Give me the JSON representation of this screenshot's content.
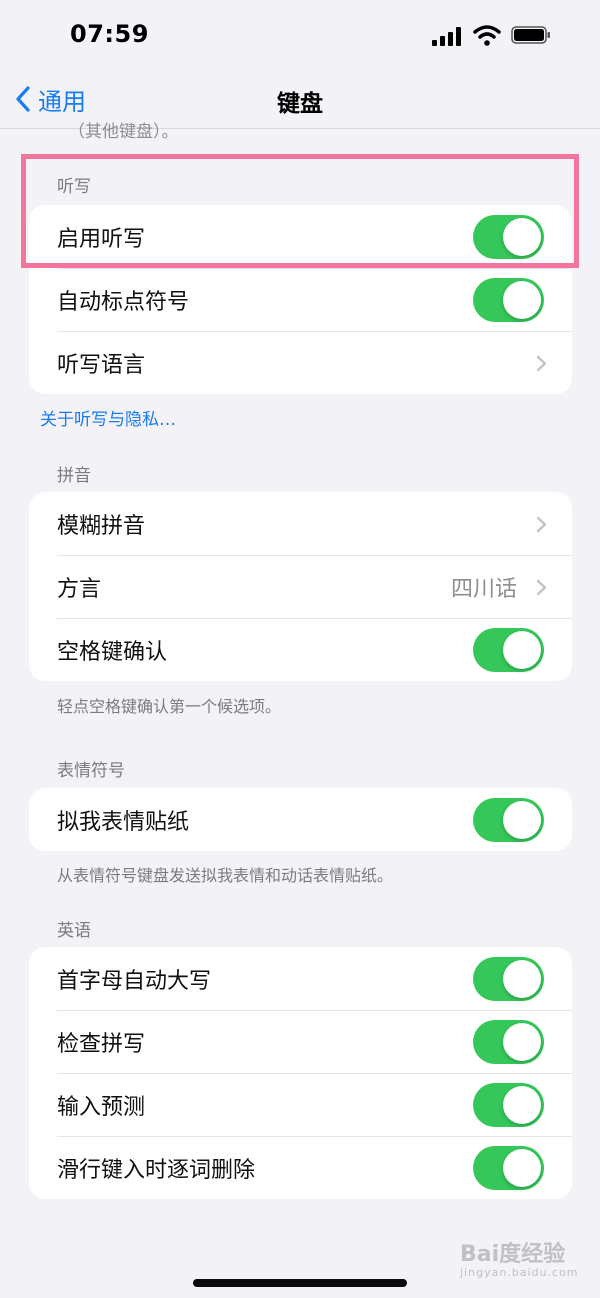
{
  "status": {
    "time": "07:59"
  },
  "nav": {
    "back_label": "通用",
    "title": "键盘"
  },
  "clipped_text": "（其他键盘）。",
  "dictation": {
    "header": "听写",
    "rows": [
      {
        "label": "启用听写",
        "toggle": true
      },
      {
        "label": "自动标点符号",
        "toggle": true
      },
      {
        "label": "听写语言"
      }
    ],
    "link": "关于听写与隐私…"
  },
  "pinyin": {
    "header": "拼音",
    "rows": [
      {
        "label": "模糊拼音"
      },
      {
        "label": "方言",
        "value": "四川话"
      },
      {
        "label": "空格键确认",
        "toggle": true
      }
    ],
    "footnote": "轻点空格键确认第一个候选项。"
  },
  "emoji": {
    "header": "表情符号",
    "rows": [
      {
        "label": "拟我表情贴纸",
        "toggle": true
      }
    ],
    "footnote": "从表情符号键盘发送拟我表情和动话表情贴纸。"
  },
  "english": {
    "header": "英语",
    "rows": [
      {
        "label": "首字母自动大写",
        "toggle": true
      },
      {
        "label": "检查拼写",
        "toggle": true
      },
      {
        "label": "输入预测",
        "toggle": true
      },
      {
        "label": "滑行键入时逐词删除",
        "toggle": true
      }
    ]
  },
  "watermark": {
    "main": "Bai度经验",
    "sub": "jingyan.baidu.com"
  },
  "colors": {
    "accent": "#1a7cf4",
    "toggle_on": "#35c759",
    "highlight": "#f2759b"
  }
}
